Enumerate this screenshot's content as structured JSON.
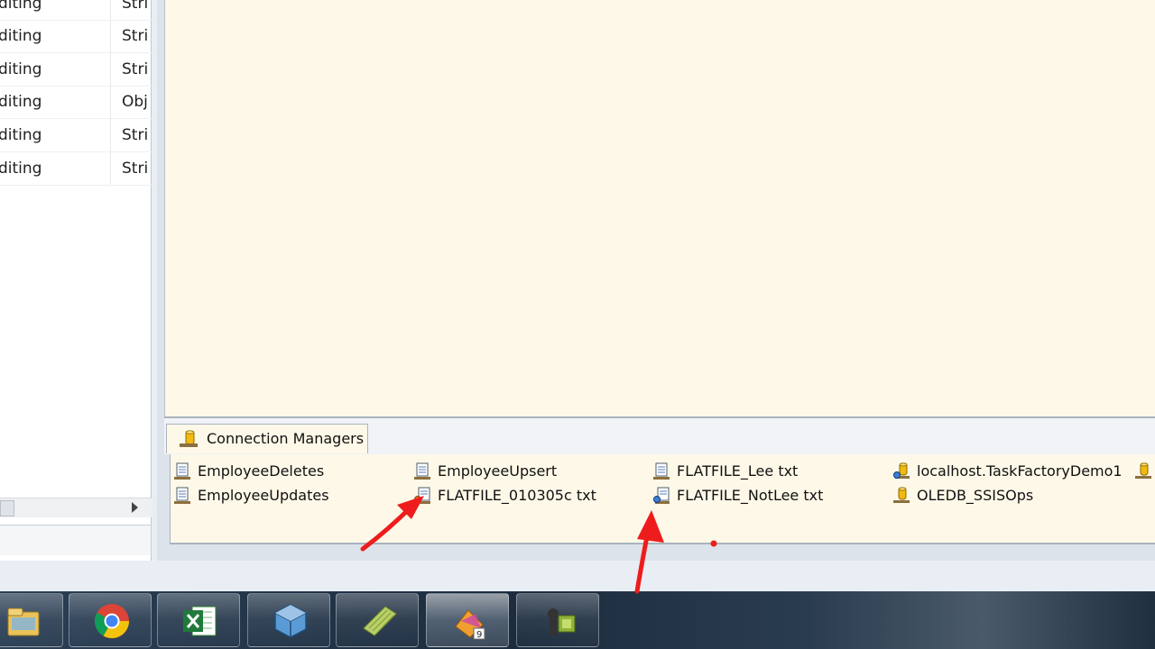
{
  "variables": {
    "rows": [
      {
        "name": "diting",
        "type": "Stri"
      },
      {
        "name": "diting",
        "type": "Stri"
      },
      {
        "name": "diting",
        "type": "Stri"
      },
      {
        "name": "diting",
        "type": "Obj"
      },
      {
        "name": "diting",
        "type": "Stri"
      },
      {
        "name": "diting",
        "type": "Stri"
      }
    ]
  },
  "connection_managers": {
    "tab_label": "Connection Managers",
    "items": [
      {
        "label": "EmployeeDeletes",
        "icon": "flat-file-icon"
      },
      {
        "label": "EmployeeUpdates",
        "icon": "flat-file-icon"
      },
      {
        "label": "EmployeeUpsert",
        "icon": "flat-file-icon"
      },
      {
        "label": "FLATFILE_010305c txt",
        "icon": "flat-file-expression-icon"
      },
      {
        "label": "FLATFILE_Lee txt",
        "icon": "flat-file-icon"
      },
      {
        "label": "FLATFILE_NotLee txt",
        "icon": "flat-file-expression-icon"
      },
      {
        "label": "localhost.TaskFactoryDemo1",
        "icon": "database-expression-icon"
      },
      {
        "label": "OLEDB_SSISOps",
        "icon": "database-icon"
      }
    ]
  },
  "taskbar": {
    "apps": [
      {
        "name": "windows-explorer-icon"
      },
      {
        "name": "chrome-icon"
      },
      {
        "name": "excel-icon"
      },
      {
        "name": "virtualbox-icon"
      },
      {
        "name": "notepad-icon"
      },
      {
        "name": "visual-studio-icon",
        "badge": "9"
      },
      {
        "name": "pragmatic-works-icon"
      }
    ]
  },
  "annotation_color": "#ee1c1c"
}
